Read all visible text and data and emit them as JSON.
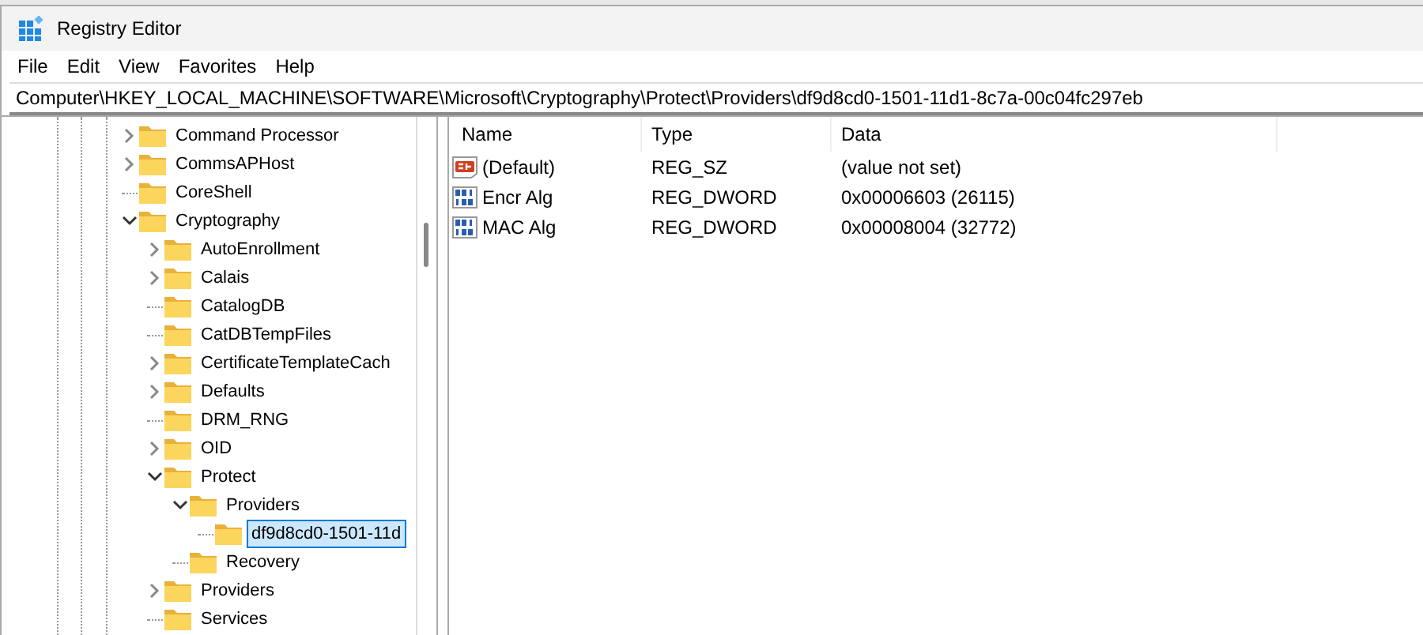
{
  "window": {
    "title": "Registry Editor"
  },
  "menu": [
    "File",
    "Edit",
    "View",
    "Favorites",
    "Help"
  ],
  "address": "Computer\\HKEY_LOCAL_MACHINE\\SOFTWARE\\Microsoft\\Cryptography\\Protect\\Providers\\df9d8cd0-1501-11d1-8c7a-00c04fc297eb",
  "tree": [
    {
      "label": "Command Processor",
      "kind": "branch",
      "expanded": false,
      "selected": false
    },
    {
      "label": "CommsAPHost",
      "kind": "branch",
      "expanded": false,
      "selected": false
    },
    {
      "label": "CoreShell",
      "kind": "leaf",
      "selected": false
    },
    {
      "label": "Cryptography",
      "kind": "branch",
      "expanded": true,
      "selected": false,
      "children": [
        {
          "label": "AutoEnrollment",
          "kind": "branch",
          "expanded": false,
          "selected": false
        },
        {
          "label": "Calais",
          "kind": "branch",
          "expanded": false,
          "selected": false
        },
        {
          "label": "CatalogDB",
          "kind": "leaf",
          "selected": false
        },
        {
          "label": "CatDBTempFiles",
          "kind": "leaf",
          "selected": false
        },
        {
          "label": "CertificateTemplateCach",
          "kind": "branch",
          "expanded": false,
          "selected": false
        },
        {
          "label": "Defaults",
          "kind": "branch",
          "expanded": false,
          "selected": false
        },
        {
          "label": "DRM_RNG",
          "kind": "leaf",
          "selected": false
        },
        {
          "label": "OID",
          "kind": "branch",
          "expanded": false,
          "selected": false
        },
        {
          "label": "Protect",
          "kind": "branch",
          "expanded": true,
          "selected": false,
          "children": [
            {
              "label": "Providers",
              "kind": "branch",
              "expanded": true,
              "selected": false,
              "children": [
                {
                  "label": "df9d8cd0-1501-11d",
                  "kind": "leaf",
                  "selected": true
                }
              ]
            },
            {
              "label": "Recovery",
              "kind": "leaf",
              "selected": false
            }
          ]
        },
        {
          "label": "Providers",
          "kind": "branch",
          "expanded": false,
          "selected": false
        },
        {
          "label": "Services",
          "kind": "leaf",
          "selected": false
        }
      ]
    }
  ],
  "values": {
    "columns": [
      "Name",
      "Type",
      "Data"
    ],
    "rows": [
      {
        "kind": "string",
        "name": "(Default)",
        "type": "REG_SZ",
        "data": "(value not set)"
      },
      {
        "kind": "binary",
        "name": "Encr Alg",
        "type": "REG_DWORD",
        "data": "0x00006603 (26115)"
      },
      {
        "kind": "binary",
        "name": "MAC Alg",
        "type": "REG_DWORD",
        "data": "0x00008004 (32772)"
      }
    ]
  }
}
